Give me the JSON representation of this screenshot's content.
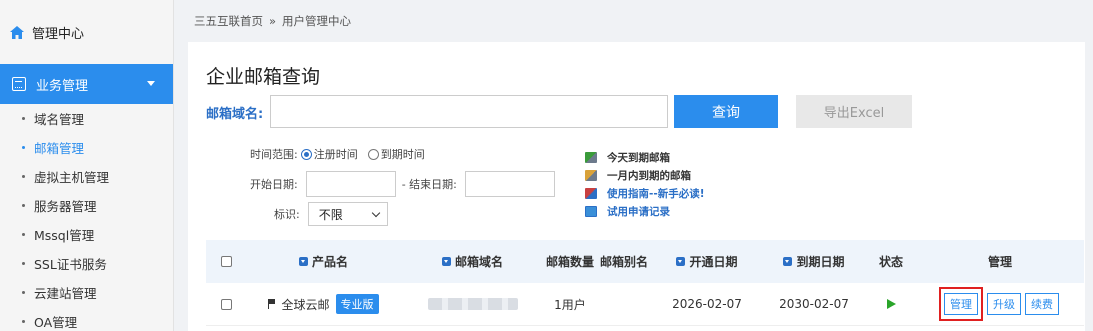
{
  "sidebar": {
    "home_label": "管理中心",
    "section_label": "业务管理",
    "items": [
      {
        "label": "域名管理"
      },
      {
        "label": "邮箱管理"
      },
      {
        "label": "虚拟主机管理"
      },
      {
        "label": "服务器管理"
      },
      {
        "label": "Mssql管理"
      },
      {
        "label": "SSL证书服务"
      },
      {
        "label": "云建站管理"
      },
      {
        "label": "OA管理"
      }
    ],
    "active_index": 1
  },
  "breadcrumb": {
    "home": "三五互联首页",
    "separator": "»",
    "current": "用户管理中心"
  },
  "page": {
    "title": "企业邮箱查询",
    "domain_label": "邮箱域名:",
    "query_button": "查询",
    "export_button": "导出Excel"
  },
  "filters": {
    "time_range_label": "时间范围:",
    "option_register": "注册时间",
    "option_expire": "到期时间",
    "selected": "注册时间",
    "start_label": "开始日期:",
    "end_label": "- 结束日期:",
    "tag_label": "标识:",
    "tag_value": "不限"
  },
  "links": [
    {
      "label": "今天到期邮箱"
    },
    {
      "label": "一月内到期的邮箱"
    },
    {
      "label": "使用指南--新手必读!"
    },
    {
      "label": "试用申请记录"
    }
  ],
  "table": {
    "headers": {
      "product": "产品名",
      "domain": "邮箱域名",
      "count": "邮箱数量",
      "alias": "邮箱别名",
      "open_date": "开通日期",
      "expire_date": "到期日期",
      "status": "状态",
      "manage": "管理"
    },
    "rows": [
      {
        "product": "全球云邮",
        "edition": "专业版",
        "count": "1用户",
        "alias": "",
        "open_date": "2026-02-07",
        "expire_date": "2030-02-07",
        "actions": {
          "manage": "管理",
          "upgrade": "升级",
          "renew": "续费"
        }
      }
    ]
  },
  "colors": {
    "accent": "#2b8ded",
    "link_blue": "#2b6fc6",
    "status_green": "#2aa52a",
    "highlight_red": "#e02020"
  }
}
